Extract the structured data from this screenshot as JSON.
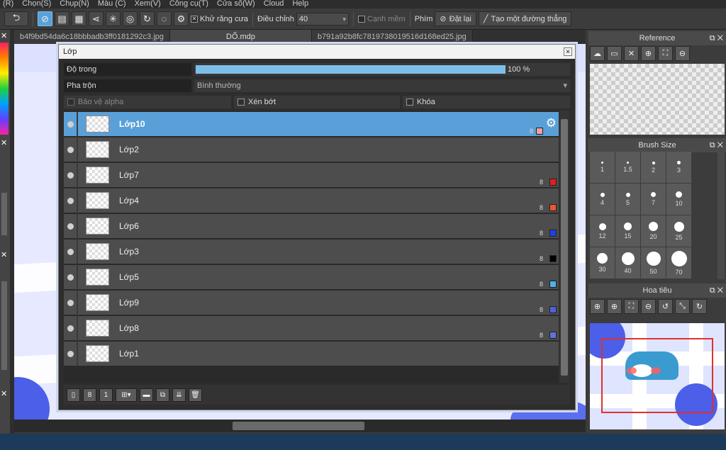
{
  "menu": [
    "(R)",
    "Chọn(S)",
    "Chụp(N)",
    "Màu (C)",
    "Xem(V)",
    "Công cụ(T)",
    "Cửa sổ(W)",
    "Cloud",
    "Help"
  ],
  "toolbar": {
    "antialias_label": "Khử răng cưa",
    "adjust_label": "Điều chỉnh",
    "adjust_value": "40",
    "soft_edge_label": "Cạnh mềm",
    "key_label": "Phím",
    "reset_label": "Đặt lại",
    "straight_line_label": "Tạo một đường thẳng"
  },
  "doc_tabs": [
    "b4f9bd54da6c18bbbadb3ff0181292c3.jpg",
    "DỐ.mdp",
    "b791a92b8fc7819738019516d168ed25.jpg"
  ],
  "layer_dialog": {
    "title": "Lớp",
    "opacity_label": "Độ trong",
    "opacity_value": "100 %",
    "opacity_fraction": 1.0,
    "blend_label": "Pha trộn",
    "blend_value": "Bình thường",
    "protect_alpha_label": "Bảo vệ alpha",
    "clipping_label": "Xén bớt",
    "lock_label": "Khóa",
    "layers": [
      {
        "name": "Lớp10",
        "bits": "8",
        "color": "#f0a0a0",
        "selected": true
      },
      {
        "name": "Lớp2",
        "bits": "",
        "color": ""
      },
      {
        "name": "Lớp7",
        "bits": "8",
        "color": "#e02020"
      },
      {
        "name": "Lớp4",
        "bits": "8",
        "color": "#ee5533"
      },
      {
        "name": "Lớp6",
        "bits": "8",
        "color": "#2040e0"
      },
      {
        "name": "Lớp3",
        "bits": "8",
        "color": "#000000"
      },
      {
        "name": "Lớp5",
        "bits": "8",
        "color": "#50b0f0"
      },
      {
        "name": "Lớp9",
        "bits": "8",
        "color": "#5060e0"
      },
      {
        "name": "Lớp8",
        "bits": "8",
        "color": "#6070e0"
      },
      {
        "name": "Lớp1",
        "bits": "",
        "color": ""
      }
    ]
  },
  "panels": {
    "reference_title": "Reference",
    "brush_size_title": "Brush Size",
    "navigator_title": "Hoa tiêu",
    "brush_sizes": [
      "1",
      "1.5",
      "2",
      "3",
      "4",
      "5",
      "7",
      "10",
      "12",
      "15",
      "20",
      "25",
      "30",
      "40",
      "50",
      "70"
    ]
  }
}
